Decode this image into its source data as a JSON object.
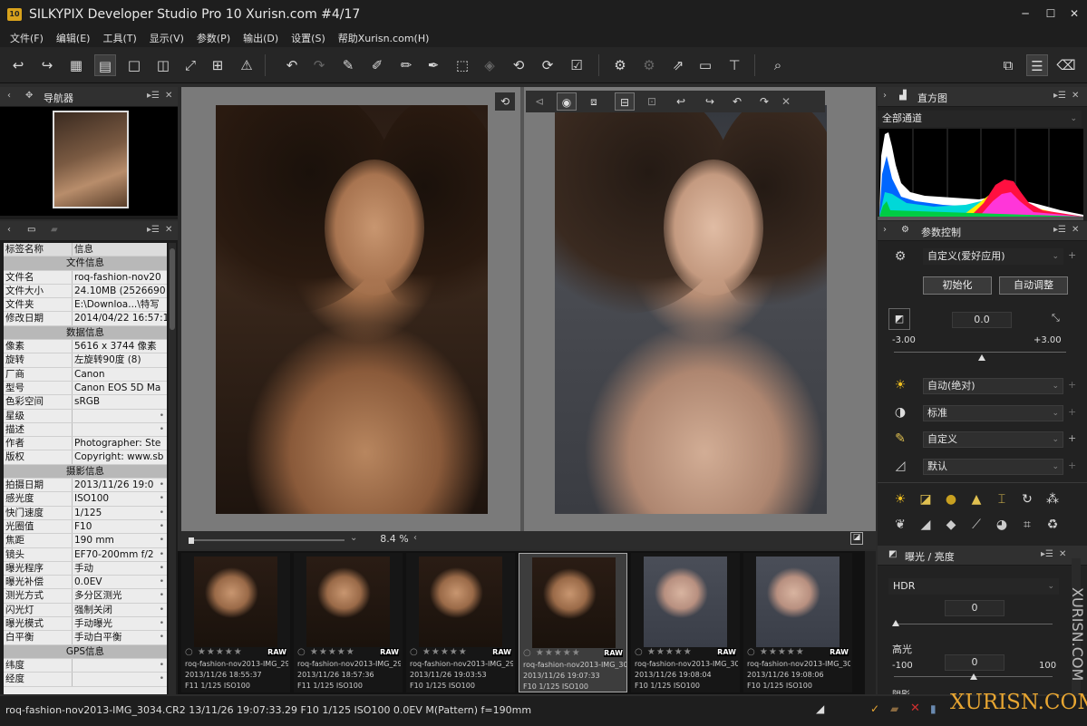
{
  "app": {
    "title": "SILKYPIX Developer Studio Pro 10 Xurisn.com   #4/17",
    "icon_label": "10",
    "window_buttons": [
      "─",
      "☐",
      "✕"
    ]
  },
  "menu": [
    "文件(F)",
    "编辑(E)",
    "工具(T)",
    "显示(V)",
    "参数(P)",
    "输出(D)",
    "设置(S)",
    "帮助Xurisn.com(H)"
  ],
  "navigator": {
    "title": "导航器"
  },
  "info_panel": {
    "header_key": "标签名称",
    "header_val": "信息",
    "rows": [
      {
        "section": "文件信息"
      },
      {
        "k": "文件名",
        "v": "roq-fashion-nov20"
      },
      {
        "k": "文件大小",
        "v": "24.10MB (2526690"
      },
      {
        "k": "文件夹",
        "v": "E:\\Downloa...\\特写"
      },
      {
        "k": "修改日期",
        "v": "2014/04/22 16:57:1"
      },
      {
        "section": "数据信息"
      },
      {
        "k": "像素",
        "v": "5616 x 3744 像素"
      },
      {
        "k": "旋转",
        "v": "左旋转90度 (8)"
      },
      {
        "k": "厂商",
        "v": "Canon"
      },
      {
        "k": "型号",
        "v": "Canon EOS 5D Ma"
      },
      {
        "k": "色彩空间",
        "v": "sRGB"
      },
      {
        "k": "星级",
        "v": "",
        "dot": true
      },
      {
        "k": "描述",
        "v": "",
        "dot": true
      },
      {
        "k": "作者",
        "v": "Photographer: Ste"
      },
      {
        "k": "版权",
        "v": "Copyright: www.sb"
      },
      {
        "section": "摄影信息"
      },
      {
        "k": "拍摄日期",
        "v": "2013/11/26 19:0",
        "dot": true
      },
      {
        "k": "感光度",
        "v": "ISO100",
        "dot": true
      },
      {
        "k": "快门速度",
        "v": "1/125",
        "dot": true
      },
      {
        "k": "光圈值",
        "v": "F10",
        "dot": true
      },
      {
        "k": "焦距",
        "v": "190 mm",
        "dot": true
      },
      {
        "k": "镜头",
        "v": "EF70-200mm f/2",
        "dot": true
      },
      {
        "k": "曝光程序",
        "v": "手动",
        "dot": true
      },
      {
        "k": "曝光补偿",
        "v": "0.0EV",
        "dot": true
      },
      {
        "k": "测光方式",
        "v": "多分区测光",
        "dot": true
      },
      {
        "k": "闪光灯",
        "v": "强制关闭",
        "dot": true
      },
      {
        "k": "曝光模式",
        "v": "手动曝光",
        "dot": true
      },
      {
        "k": "白平衡",
        "v": "手动白平衡",
        "dot": true
      },
      {
        "section": "GPS信息"
      },
      {
        "k": "纬度",
        "v": "",
        "dot": true
      },
      {
        "k": "经度",
        "v": "",
        "dot": true
      }
    ]
  },
  "viewer": {
    "zoom": "8.4 %"
  },
  "filmstrip": [
    {
      "name": "roq-fashion-nov2013-IMG_29",
      "date": "2013/11/26 18:55:37",
      "exif": "F11 1/125 ISO100",
      "raw": "RAW",
      "tone": "warm"
    },
    {
      "name": "roq-fashion-nov2013-IMG_29",
      "date": "2013/11/26 18:57:36",
      "exif": "F11 1/125 ISO100",
      "raw": "RAW",
      "tone": "warm"
    },
    {
      "name": "roq-fashion-nov2013-IMG_29",
      "date": "2013/11/26 19:03:53",
      "exif": "F10 1/125 ISO100",
      "raw": "RAW",
      "tone": "warm"
    },
    {
      "name": "roq-fashion-nov2013-IMG_30",
      "date": "2013/11/26 19:07:33",
      "exif": "F10 1/125 ISO100",
      "raw": "RAW",
      "tone": "warm",
      "selected": true
    },
    {
      "name": "roq-fashion-nov2013-IMG_30",
      "date": "2013/11/26 19:08:04",
      "exif": "F10 1/125 ISO100",
      "raw": "RAW",
      "tone": "cool"
    },
    {
      "name": "roq-fashion-nov2013-IMG_30",
      "date": "2013/11/26 19:08:06",
      "exif": "F10 1/125 ISO100",
      "raw": "RAW",
      "tone": "cool"
    }
  ],
  "status": {
    "text": "roq-fashion-nov2013-IMG_3034.CR2 13/11/26 19:07:33.29 F10 1/125 ISO100  0.0EV M(Pattern) f=190mm"
  },
  "watermark": {
    "text": "XURISN.COM",
    "vertical": "XURISN.COM"
  },
  "histogram": {
    "title": "直方图",
    "channel": "全部通道"
  },
  "params": {
    "title": "参数控制",
    "preset": "自定义(爱好应用)",
    "init_button": "初始化",
    "auto_button": "自动调整",
    "exposure_value": "0.0",
    "exposure_min": "-3.00",
    "exposure_max": "+3.00",
    "wb": "自动(绝对)",
    "tone": "标准",
    "color": "自定义",
    "sharp": "默认"
  },
  "exposure_panel": {
    "title": "曝光 / 亮度",
    "mode": "HDR",
    "hdr_value": "0",
    "highlight_label": "高光",
    "highlight_value": "0",
    "highlight_min": "-100",
    "highlight_max": "100",
    "shadow_label": "阴影"
  },
  "colors": {
    "accent": "#e8a632",
    "panel": "#222222",
    "title_bar": "#1e1e1e"
  }
}
